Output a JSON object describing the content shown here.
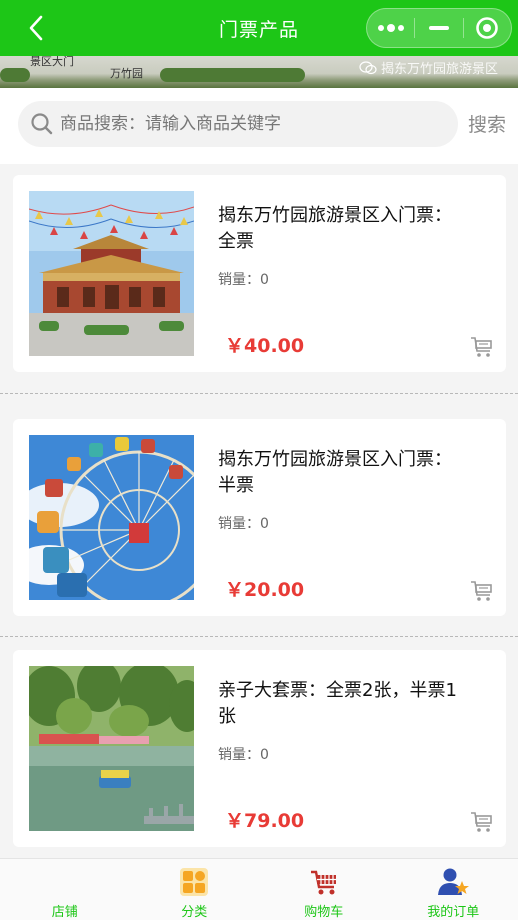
{
  "header": {
    "title": "门票产品",
    "back_icon": "chevron-left-icon",
    "more_icon": "more-dots-icon",
    "minimize_icon": "minimize-icon",
    "close_icon": "target-close-icon",
    "color": "#1dc617"
  },
  "banner": {
    "sign_line1": "景区大门",
    "sign_line2": "万竹园",
    "watermark": "揭东万竹园旅游景区"
  },
  "search": {
    "placeholder": "商品搜索：请输入商品关键字",
    "button_label": "搜索",
    "icon": "search-icon"
  },
  "products": [
    {
      "name": "揭东万竹园旅游景区入门票：全票",
      "sales": "销量：0",
      "price": "￥40.00",
      "image": "temple-photo",
      "cart_icon": "cart-icon"
    },
    {
      "name": "揭东万竹园旅游景区入门票：半票",
      "sales": "销量：0",
      "price": "￥20.00",
      "image": "ferris-wheel-photo",
      "cart_icon": "cart-icon"
    },
    {
      "name": "亲子大套票：全票2张，半票1张",
      "sales": "销量：0",
      "price": "￥79.00",
      "image": "lake-boat-photo",
      "cart_icon": "cart-icon"
    }
  ],
  "tabbar": {
    "items": [
      {
        "label": "店铺",
        "icon": "shop-icon"
      },
      {
        "label": "分类",
        "icon": "category-icon"
      },
      {
        "label": "购物车",
        "icon": "shopping-cart-icon"
      },
      {
        "label": "我的订单",
        "icon": "orders-user-icon"
      }
    ],
    "active_color": "#1dc617"
  },
  "colors": {
    "price": "#e83b36",
    "accent": "#1dc617"
  }
}
